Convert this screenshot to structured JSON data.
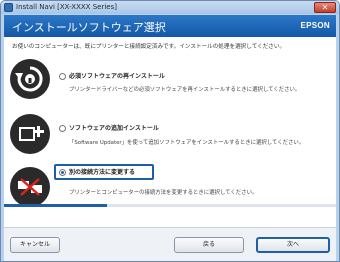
{
  "window": {
    "title": "Install Navi [XX-XXXX Series]",
    "close_glyph": "✕"
  },
  "header": {
    "title": "インストールソフトウェア選択",
    "brand": "EPSON"
  },
  "intro": "お使いのコンピューターは、既にプリンターと接続設定済みです。インストールの処理を選択してください。",
  "options": [
    {
      "title": "必須ソフトウェアの再インストール",
      "description": "プリンタードライバーなどの必須ソフトウェアを再インストールするときに選択してください。",
      "icon": "reinstall-icon",
      "selected": false
    },
    {
      "title": "ソフトウェアの追加インストール",
      "description": "「Software Updater」を使って追加ソフトウェアをインストールするときに選択してください。",
      "icon": "add-software-icon",
      "selected": false
    },
    {
      "title": "別の接続方法に変更する",
      "description": "プリンターとコンピューターの接続方法を変更するときに選択してください。",
      "icon": "change-connection-icon",
      "selected": true
    }
  ],
  "progress": 0.31,
  "buttons": {
    "cancel": "キャンセル",
    "back": "戻る",
    "next": "次へ"
  },
  "colors": {
    "header": "#1458a8",
    "accent": "#1d5fa8"
  }
}
